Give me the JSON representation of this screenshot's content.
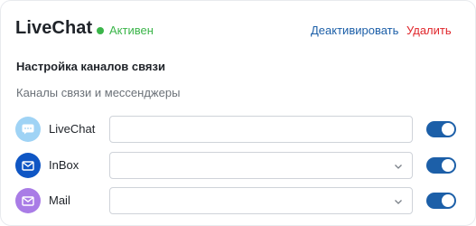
{
  "header": {
    "title": "LiveChat",
    "status_label": "Активен",
    "deactivate_label": "Деактивировать",
    "delete_label": "Удалить"
  },
  "section": {
    "title": "Настройка каналов связи",
    "subtitle": "Каналы связи и мессенджеры"
  },
  "channels": [
    {
      "label": "LiveChat",
      "icon": "chat-bubble-icon",
      "field_type": "text-input",
      "value": "",
      "enabled": true
    },
    {
      "label": "InBox",
      "icon": "envelope-icon",
      "field_type": "select",
      "value": "",
      "enabled": true
    },
    {
      "label": "Mail",
      "icon": "envelope-icon",
      "field_type": "select",
      "value": "",
      "enabled": true
    }
  ],
  "colors": {
    "status_green": "#3bb54a",
    "link_blue": "#1c5fa8",
    "danger_red": "#e0262b",
    "toggle_on": "#1c5fa8",
    "livechat_icon_bg": "#9fd3f5",
    "inbox_icon_bg": "#0f56c4",
    "mail_icon_bg": "#a97ce6"
  }
}
